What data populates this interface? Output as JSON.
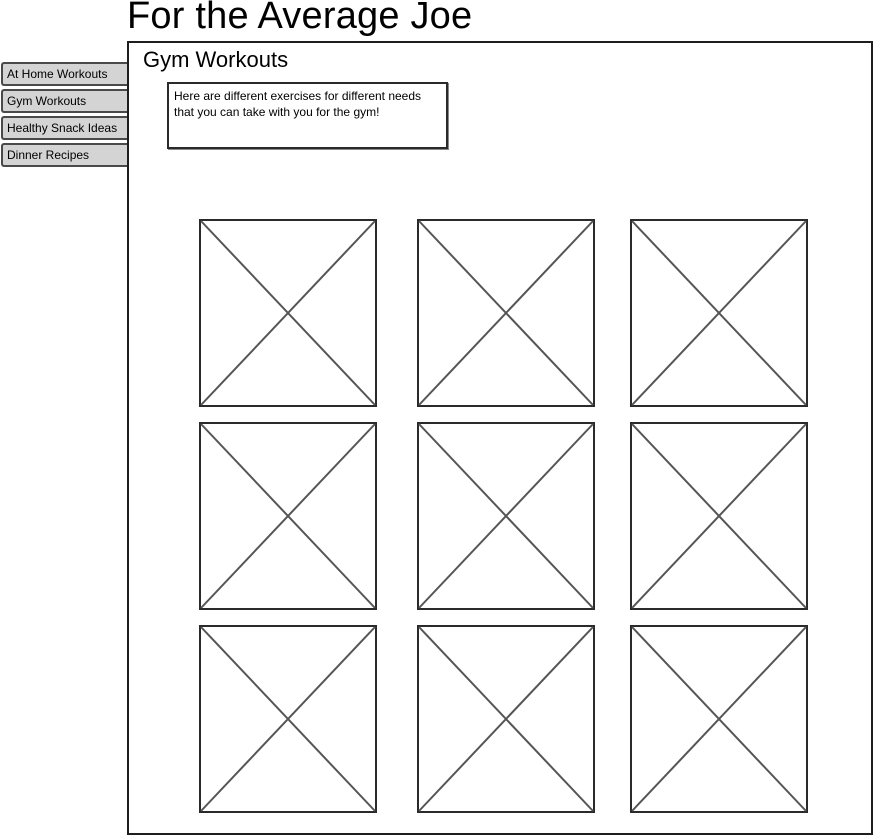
{
  "site": {
    "title": "For the Average Joe"
  },
  "nav": {
    "items": [
      {
        "label": "At Home Workouts"
      },
      {
        "label": "Gym Workouts"
      },
      {
        "label": "Healthy Snack Ideas"
      },
      {
        "label": "Dinner Recipes"
      }
    ]
  },
  "main": {
    "heading": "Gym Workouts",
    "intro": "Here are different exercises for different needs that you can take with you for the gym!",
    "image_grid": {
      "rows": 3,
      "columns": 3,
      "placeholder_icon": "image-placeholder-icon"
    }
  },
  "colors": {
    "tab_background": "#d4d4d4",
    "stroke": "#555555",
    "frame_border": "#1e1e1e"
  }
}
